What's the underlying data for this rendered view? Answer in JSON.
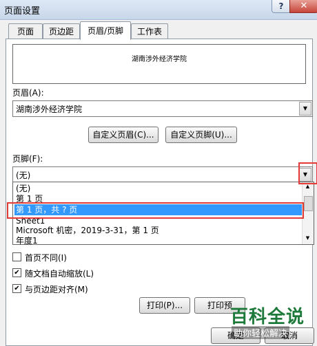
{
  "window": {
    "title": "页面设置",
    "help_label": "?",
    "close_label": "✕"
  },
  "tabs": [
    {
      "label": "页面"
    },
    {
      "label": "页边距"
    },
    {
      "label": "页眉/页脚",
      "active": true
    },
    {
      "label": "工作表"
    }
  ],
  "preview": {
    "text": "湖南涉外经济学院"
  },
  "header": {
    "label": "页眉(A):",
    "value": "湖南涉外经济学院"
  },
  "buttons": {
    "custom_header": "自定义页眉(C)...",
    "custom_footer": "自定义页脚(U)...",
    "print": "打印(P)...",
    "print_preview": "打印预",
    "ok": "确定",
    "cancel": "取消"
  },
  "footer": {
    "label": "页脚(F):",
    "value": "(无)",
    "options": [
      {
        "label": "(无)"
      },
      {
        "label": "第 1 页"
      },
      {
        "label": "第 1 页，共 ? 页",
        "selected": true
      },
      {
        "label": "Sheet1"
      },
      {
        "label": "Microsoft 机密，2019-3-31，第 1 页"
      },
      {
        "label": "年度1"
      }
    ]
  },
  "checkboxes": [
    {
      "label": "首页不同(I)",
      "checked": false
    },
    {
      "label": "随文档自动缩放(L)",
      "checked": true
    },
    {
      "label": "与页边距对齐(M)",
      "checked": true
    }
  ],
  "watermark": {
    "title": "百科全说",
    "subtitle": "助你轻松解决"
  },
  "colors": {
    "highlight": "#e53935",
    "selection": "#3399ff",
    "brand": "#1e7a3a"
  }
}
